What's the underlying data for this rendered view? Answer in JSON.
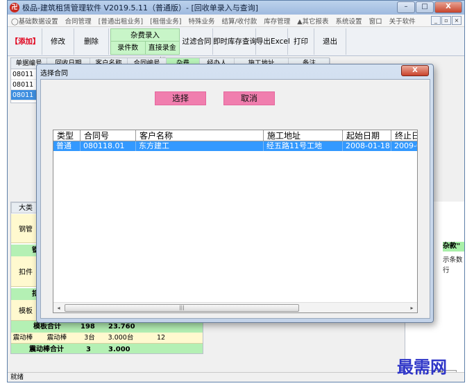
{
  "window": {
    "title": "极品-建筑租赁管理软件 V2019.5.11（普通版）- [回收单录入与查询]",
    "app_icon_glyph": "卍",
    "min_glyph": "–",
    "max_glyph": "□",
    "close_glyph": "X"
  },
  "menubar": {
    "items": [
      "◯基础数据设置",
      "合同管理",
      "[普通出租业务]",
      "[租借业务]",
      "特殊业务",
      "结算/收付款",
      "库存管理",
      "▲其它报表",
      "系统设置",
      "窗口",
      "关于软件"
    ],
    "mdi_buttons": [
      "_",
      "▫",
      "×"
    ]
  },
  "toolbar": {
    "add": "【添加】",
    "edit": "修改",
    "delete": "删除",
    "misc_group": "杂费录入",
    "record_count": "录件数",
    "direct_amount": "直接录金额",
    "filter_contract": "过滤合同",
    "instant_stock": "即时库存查询",
    "export_excel": "导出Excel",
    "print": "打印",
    "exit": "退出"
  },
  "top_grid": {
    "columns": [
      "单据编号",
      "回收日期",
      "客户名称",
      "合同编号",
      "杂费",
      "经办人",
      "施工地址",
      "备注"
    ],
    "highlight_column": "杂费",
    "rows": [
      "08011",
      "08011",
      "08011"
    ],
    "selected_row": 2
  },
  "bottom_grid": {
    "header": "大类",
    "categories": [
      "钢管",
      "扣件",
      "模板"
    ],
    "subtotal_partials": [
      "钢",
      "扣"
    ],
    "summary_rows": [
      {
        "label": "模板合计",
        "qty": "198",
        "amount": "23.760"
      }
    ],
    "vibrator_row": {
      "cat": "震动棒",
      "name": "震动棒",
      "qty": "3台",
      "amount": "3.000台",
      "days": "12"
    },
    "vibrator_total": {
      "label": "震动棒合计",
      "qty": "3",
      "amount": "3.000"
    }
  },
  "right_panel": {
    "green_label": "杂款\"",
    "text1": "示条数",
    "text2": "行",
    "box": "数字"
  },
  "status": "就绪",
  "watermark": "最需网",
  "dialog": {
    "title": "选择合同",
    "close_glyph": "X",
    "select_button": "选择",
    "cancel_button": "取消",
    "columns": [
      "类型",
      "合同号",
      "客户名称",
      "施工地址",
      "起始日期",
      "终止日"
    ],
    "rows": [
      {
        "type": "普通",
        "contract_no": "080118.01",
        "customer": "东方建工",
        "address": "经五路11号工地",
        "start": "2008-01-18",
        "end": "2009-0"
      }
    ],
    "scroll_left": "◂",
    "scroll_right": "▸",
    "scroll_grip": "|||"
  }
}
